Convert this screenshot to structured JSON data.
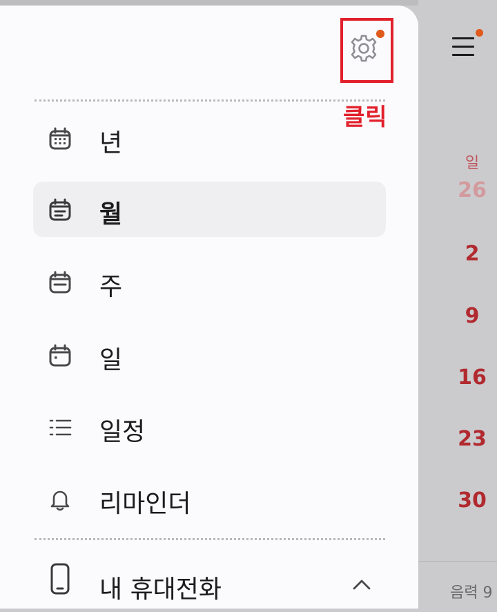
{
  "drawer": {
    "settings_icon": "gear-icon",
    "settings_badge_color": "#e05a1c",
    "annotation": {
      "label": "클릭",
      "color": "#e2202b"
    },
    "menu": [
      {
        "label": "년",
        "icon": "calendar-grid-icon",
        "selected": false
      },
      {
        "label": "월",
        "icon": "calendar-month-icon",
        "selected": true
      },
      {
        "label": "주",
        "icon": "calendar-week-icon",
        "selected": false
      },
      {
        "label": "일",
        "icon": "calendar-day-icon",
        "selected": false
      },
      {
        "label": "일정",
        "icon": "list-icon",
        "selected": false
      },
      {
        "label": "리마인더",
        "icon": "bell-icon",
        "selected": false
      }
    ],
    "device_section": {
      "label": "내 휴대전화",
      "icon": "phone-icon",
      "expanded": true
    }
  },
  "background_calendar": {
    "menu_icon": "hamburger-icon",
    "day_header": "일",
    "dates": [
      "26",
      "2",
      "9",
      "16",
      "23",
      "30"
    ],
    "lunar_text": "음력 9"
  }
}
